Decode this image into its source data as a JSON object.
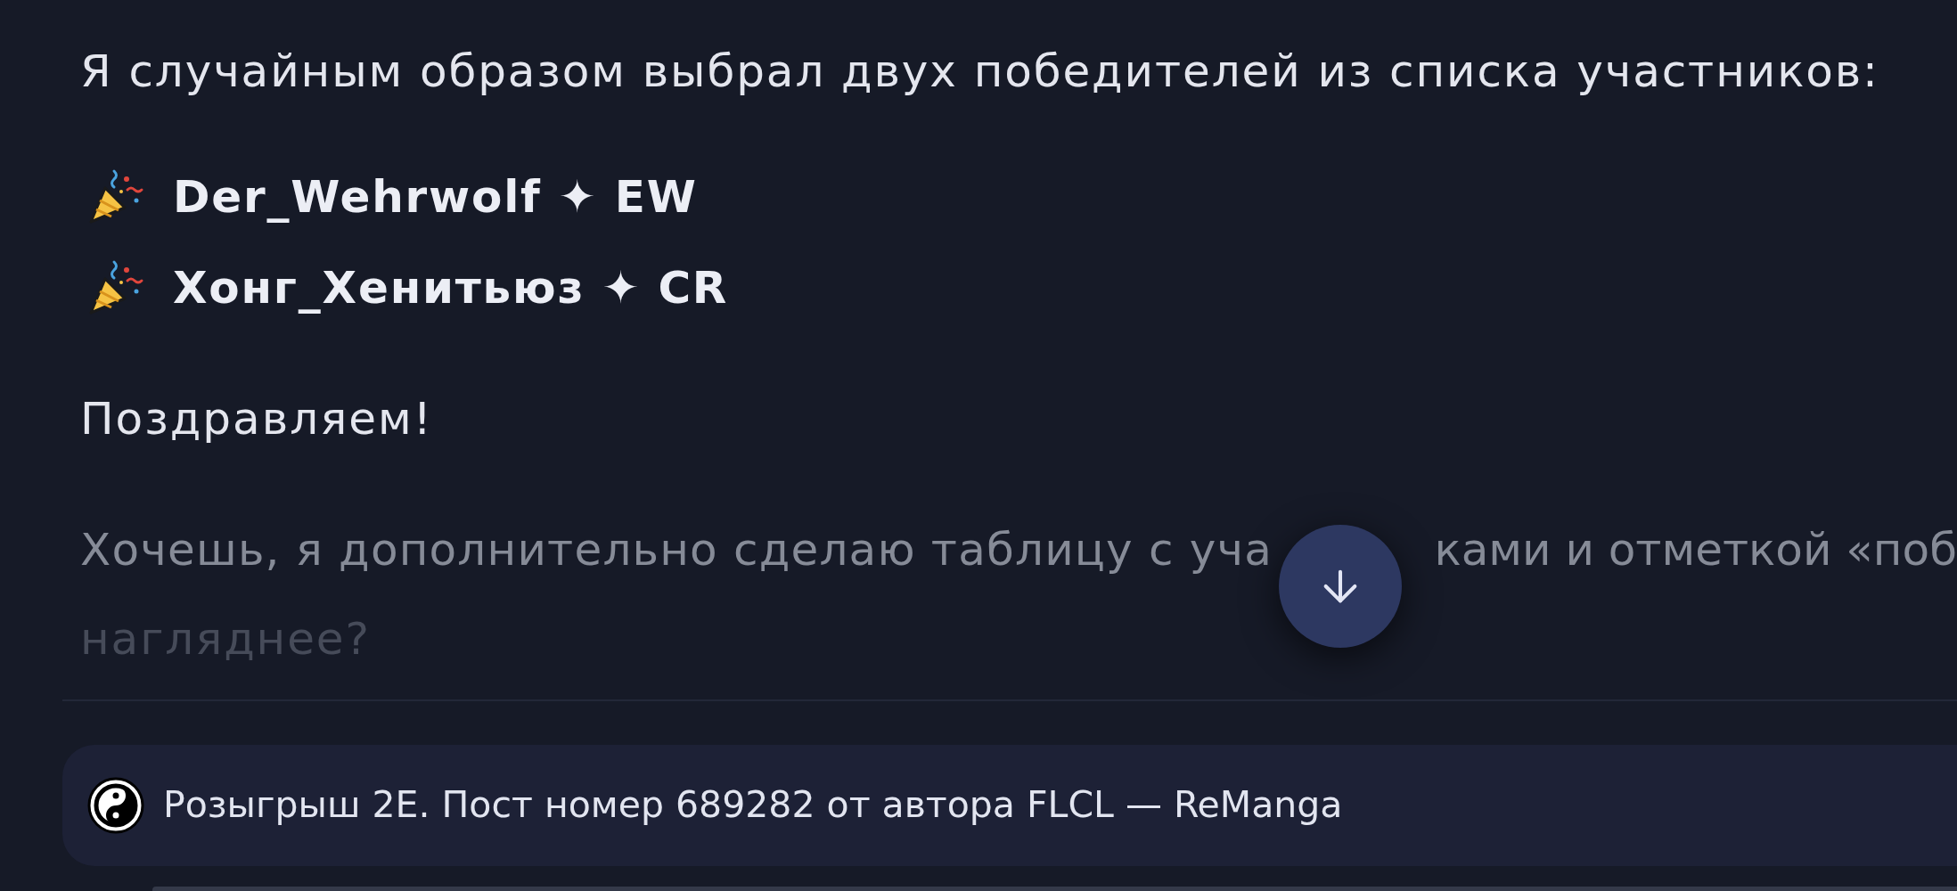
{
  "message": {
    "intro": "Я случайным образом выбрал двух победителей из списка участников:",
    "winners": [
      "Der_Wehrwolf ✦ EW",
      "Хонг_Хенитьюз ✦ CR"
    ],
    "congrats": "Поздравляем!",
    "follow_up_fragments": [
      "Хочешь, я дополнительно сделаю таблицу с уча",
      "ками и отметкой «поб",
      "нагляднее?"
    ]
  },
  "source_link": {
    "text": "Розыгрыш 2E. Пост номер 689282 от автора FLCL — ReManga"
  }
}
